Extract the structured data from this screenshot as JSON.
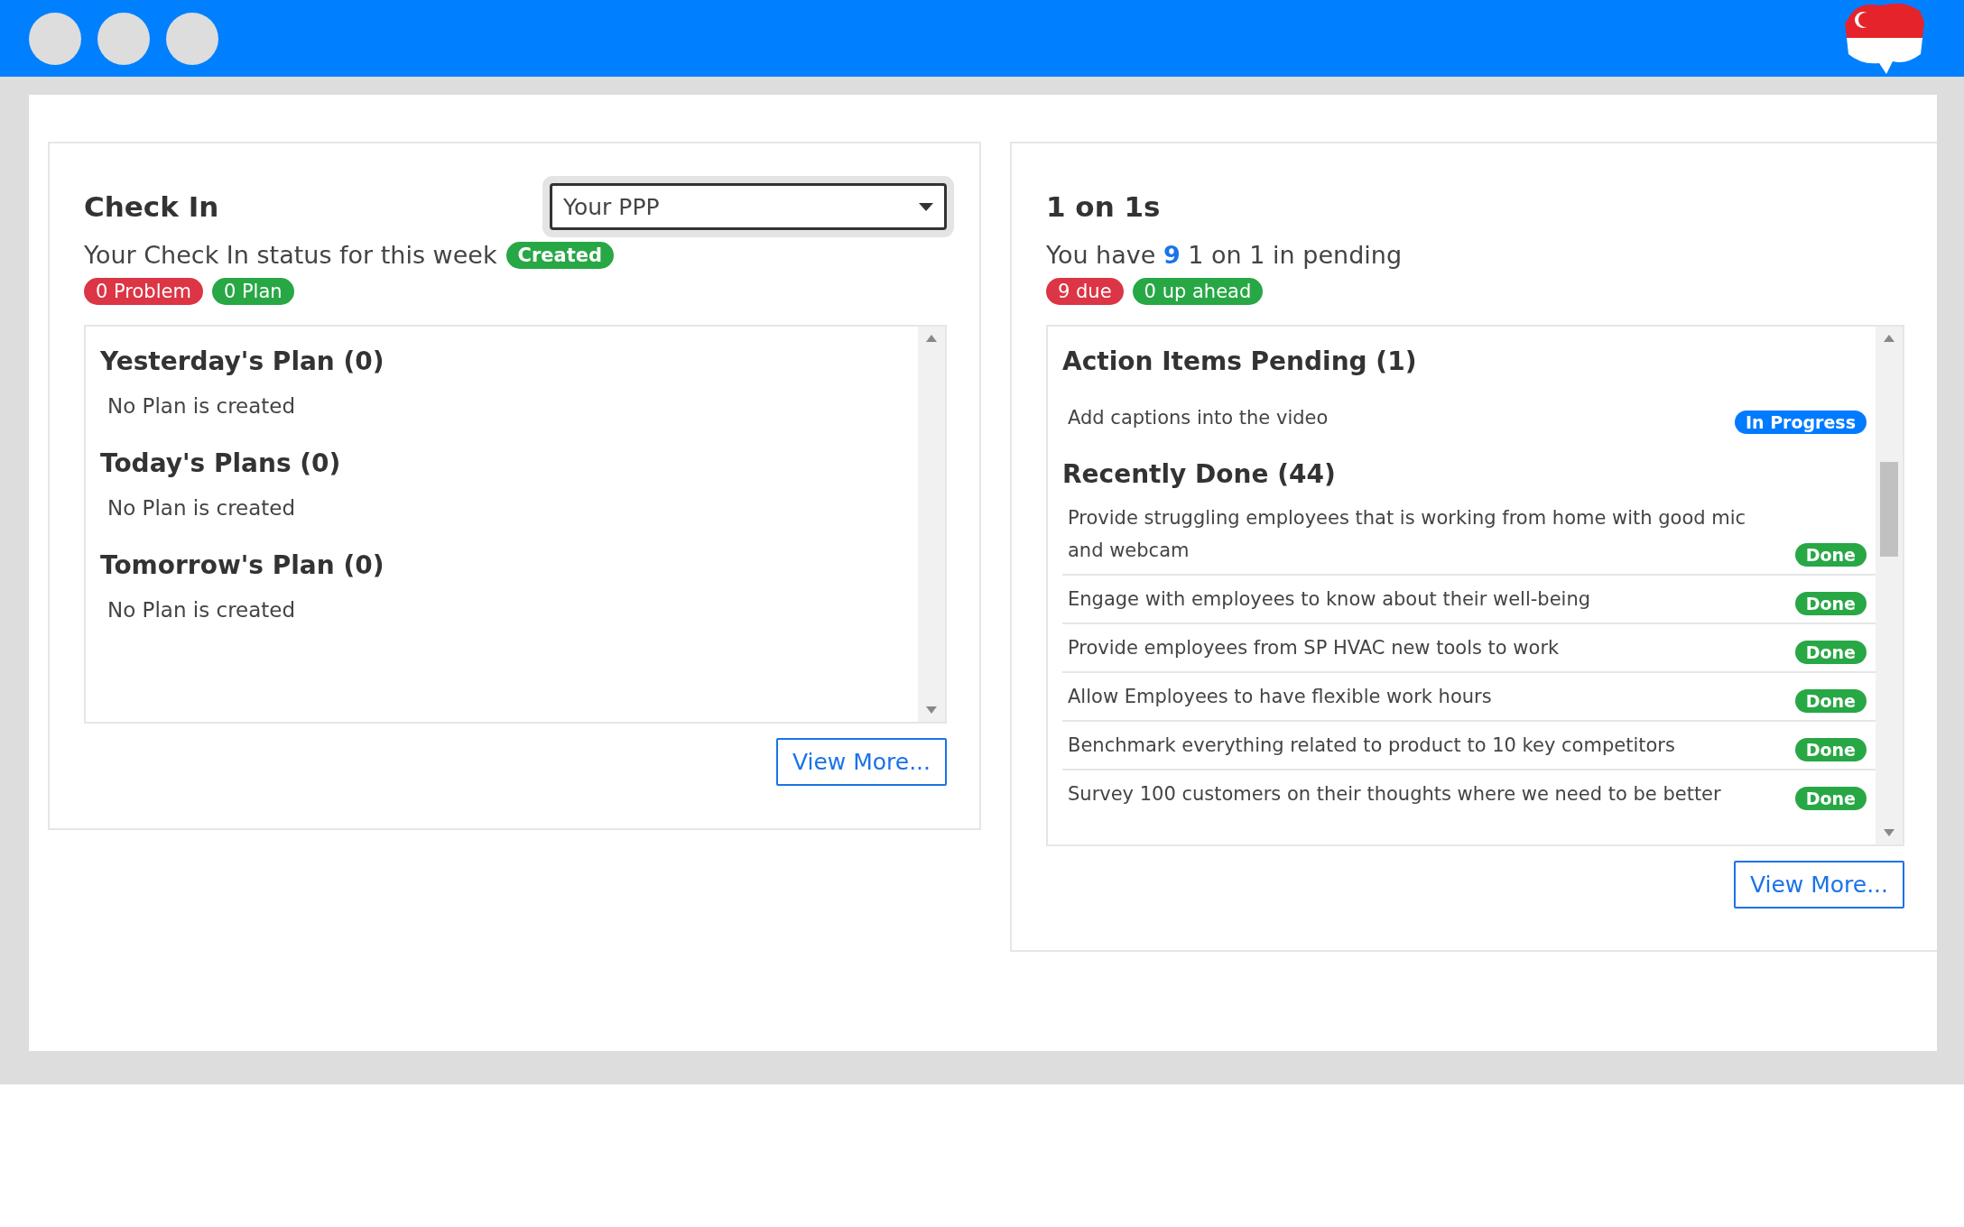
{
  "check_in": {
    "title": "Check In",
    "dropdown": {
      "value": "Your PPP"
    },
    "status_text": "Your Check In status for this week",
    "status_badge": {
      "label": "Created",
      "color": "#28a745"
    },
    "badges": [
      {
        "label": "0 Problem",
        "color": "#dc3545"
      },
      {
        "label": "0 Plan",
        "color": "#28a745"
      }
    ],
    "sections": [
      {
        "heading": "Yesterday's Plan (0)",
        "empty_text": "No Plan is created"
      },
      {
        "heading": "Today's Plans (0)",
        "empty_text": "No Plan is created"
      },
      {
        "heading": "Tomorrow's Plan (0)",
        "empty_text": "No Plan is created"
      }
    ],
    "view_more": "View More..."
  },
  "one_on_ones": {
    "title": "1 on 1s",
    "summary": "You have **9** 1 on 1 in pending",
    "badges": [
      {
        "label": "9 due",
        "color": "#dc3545"
      },
      {
        "label": "0 up ahead",
        "color": "#28a745"
      }
    ],
    "action_items": {
      "heading": "Action Items Pending (1)",
      "items": [
        {
          "text": "Add captions into the video",
          "status": "In Progress",
          "color": "#007bff"
        }
      ]
    },
    "recently_done": {
      "heading": "Recently Done (44)",
      "items": [
        {
          "text": "Provide struggling employees that is working from home with good mic and webcam",
          "status": "Done",
          "color": "#28a745"
        },
        {
          "text": "Engage with employees to know about their well-being",
          "status": "Done",
          "color": "#28a745"
        },
        {
          "text": "Provide employees from SP HVAC new tools to work",
          "status": "Done",
          "color": "#28a745"
        },
        {
          "text": "Allow Employees to have flexible work hours",
          "status": "Done",
          "color": "#28a745"
        },
        {
          "text": "Benchmark everything related to product to 10 key competitors",
          "status": "Done",
          "color": "#28a745"
        },
        {
          "text": "Survey 100 customers on their thoughts where we need to be better",
          "status": "Done",
          "color": "#28a745"
        }
      ]
    },
    "view_more": "View More..."
  }
}
